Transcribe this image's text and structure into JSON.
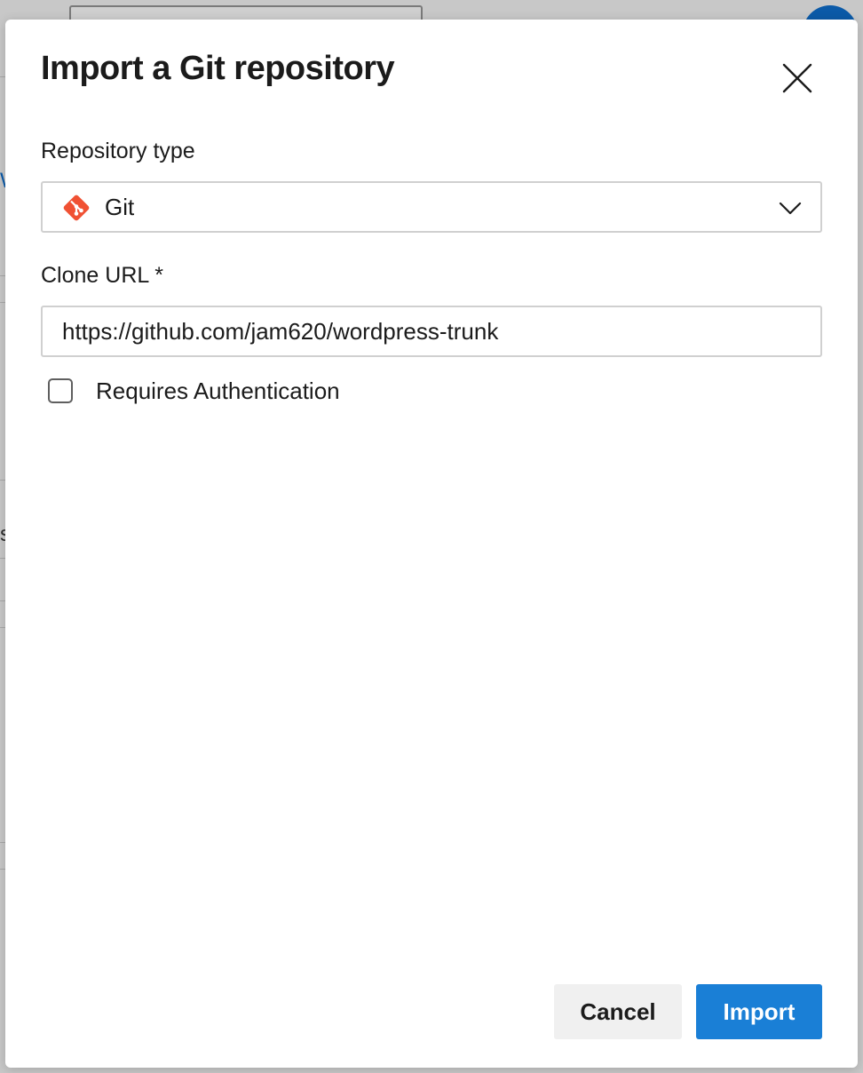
{
  "background": {
    "partial_glyphs": [
      "W",
      "s"
    ]
  },
  "dialog": {
    "title": "Import a Git repository",
    "close_icon": "close-icon",
    "repository_type": {
      "label": "Repository type",
      "selected": "Git",
      "icon": "git-icon"
    },
    "clone_url": {
      "label": "Clone URL *",
      "value": "https://github.com/jam620/wordpress-trunk"
    },
    "requires_auth": {
      "label": "Requires Authentication",
      "checked": false
    },
    "buttons": {
      "cancel": "Cancel",
      "import": "Import"
    }
  },
  "colors": {
    "accent": "#1a7fd6",
    "git_brand": "#f05133",
    "overlay": "#c8c8c8"
  }
}
